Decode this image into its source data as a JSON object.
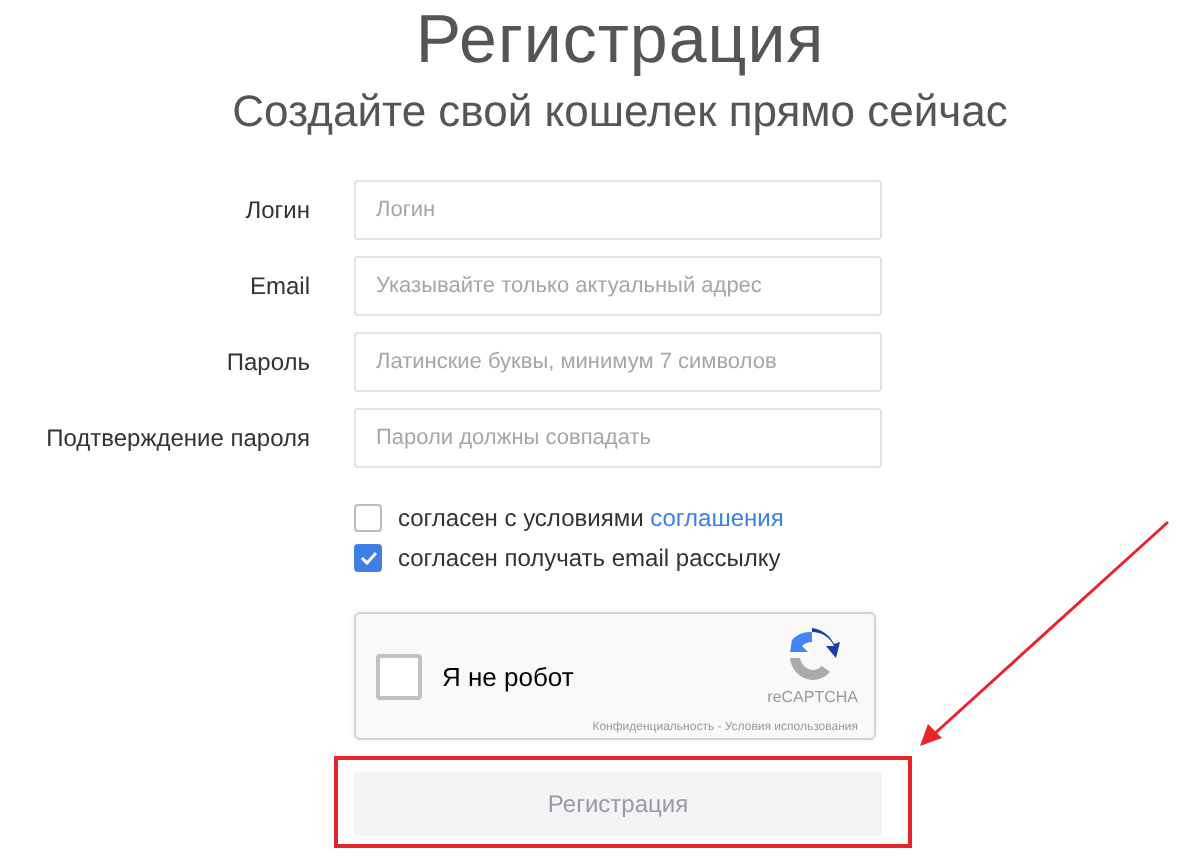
{
  "header": {
    "title": "Регистрация",
    "subtitle": "Создайте свой кошелек прямо сейчас"
  },
  "fields": [
    {
      "label": "Логин",
      "placeholder": "Логин"
    },
    {
      "label": "Email",
      "placeholder": "Указывайте только актуальный адрес"
    },
    {
      "label": "Пароль",
      "placeholder": "Латинские буквы, минимум 7 символов"
    },
    {
      "label": "Подтверждение пароля",
      "placeholder": "Пароли должны совпадать"
    }
  ],
  "checkboxes": [
    {
      "text": "согласен с условиями",
      "link": "соглашения",
      "checked": false
    },
    {
      "text": "согласен получать email рассылку",
      "checked": true
    }
  ],
  "captcha": {
    "label": "Я не робот",
    "checked": false,
    "brand": "reCAPTCHA",
    "footer": "Конфиденциальность - Условия использования"
  },
  "submit": {
    "label": "Регистрация",
    "disabled": true
  }
}
